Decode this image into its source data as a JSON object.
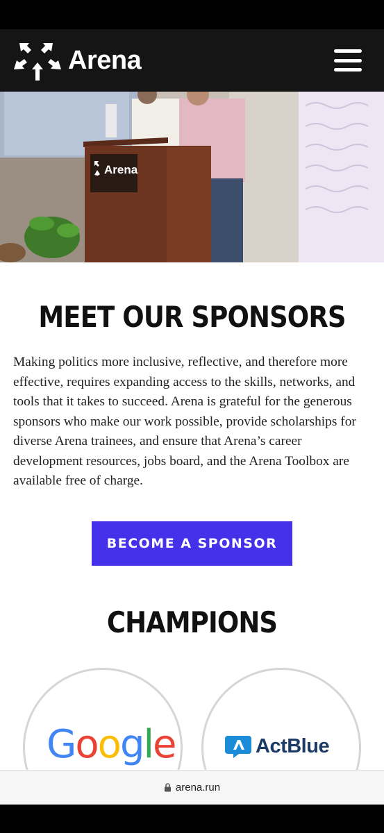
{
  "header": {
    "logo_text": "Arena",
    "menu_icon": "hamburger-menu-icon"
  },
  "hero": {
    "podium_text": "Arena"
  },
  "sponsors": {
    "title": "MEET OUR SPONSORS",
    "body": "Making politics more inclusive, reflective, and therefore more effective, requires expanding access to the skills, networks, and tools that it takes to succeed. Arena is grateful for the generous sponsors who make our work possible, provide scholarships for diverse Arena trainees, and ensure that Arena’s career development resources, jobs board, and the Arena Toolbox are available free of charge.",
    "cta_label": "BECOME A SPONSOR"
  },
  "champions": {
    "title": "CHAMPIONS",
    "logos": [
      {
        "name": "Google"
      },
      {
        "name": "ActBlue"
      }
    ]
  },
  "browser": {
    "url": "arena.run"
  },
  "colors": {
    "header_bg": "#151515",
    "cta_bg": "#4531ea",
    "actblue_blue": "#1a8cd8"
  }
}
